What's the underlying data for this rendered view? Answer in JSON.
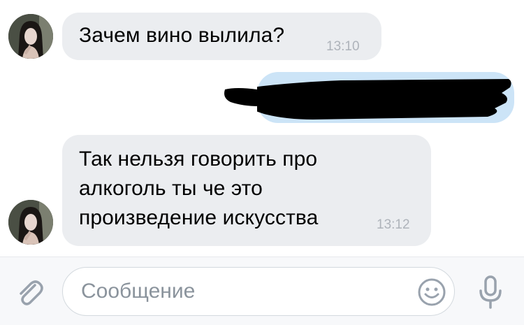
{
  "messages": [
    {
      "direction": "incoming",
      "text": "Зачем вино вылила?",
      "time": "13:10"
    },
    {
      "direction": "outgoing",
      "redacted": true
    },
    {
      "direction": "incoming",
      "text": "Так нельзя говорить про алкоголь ты че это произведение искусства",
      "time": "13:12"
    }
  ],
  "composer": {
    "placeholder": "Сообщение",
    "attach_icon": "paperclip-icon",
    "emoji_icon": "smiley-icon",
    "mic_icon": "microphone-icon"
  },
  "colors": {
    "incoming_bubble": "#ebedf0",
    "outgoing_bubble": "#cce4f7",
    "timestamp": "#aeb3ba",
    "icon": "#99a2ad"
  }
}
